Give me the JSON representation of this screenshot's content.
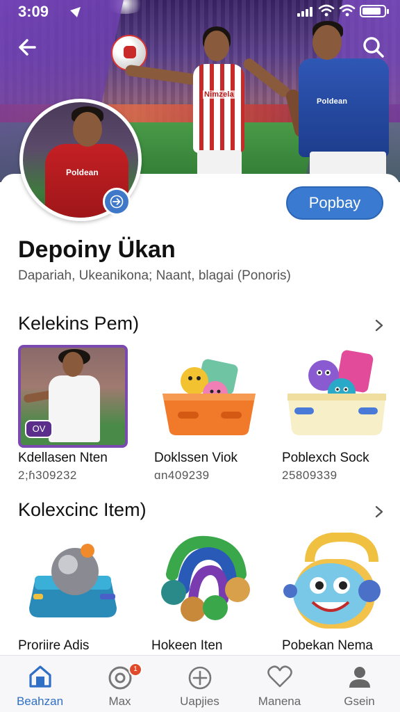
{
  "status_bar": {
    "time": "3:09"
  },
  "header": {
    "back_icon": "arrow-left-icon",
    "search_icon": "search-icon",
    "primary_button_label": "Popbay"
  },
  "profile": {
    "name": "Depoiny Ükan",
    "description": "Dapariah, Ukeanikona; Naant, blagai (Ponoris)",
    "avatar_jersey_text": "Poldean"
  },
  "hero": {
    "player1_jersey_text": "Nimzela",
    "player2_jersey_text": "Poldean"
  },
  "section1": {
    "title": "Kelekins Pem)",
    "items": [
      {
        "label": "Kdellasen Nten",
        "sub": "2;ɦ309232",
        "badge": "OV"
      },
      {
        "label": "Doklssen Viok",
        "sub": "ɑn409239"
      },
      {
        "label": "Poblexch Sock",
        "sub": "25809339"
      }
    ]
  },
  "section2": {
    "title": "Kolexcinc Item)",
    "items": [
      {
        "label": "Proriire Adis"
      },
      {
        "label": "Hokeen Iten"
      },
      {
        "label": "Pobekan Nema"
      }
    ]
  },
  "bottom_nav": {
    "items": [
      {
        "label": "Beahzan",
        "icon": "home-icon",
        "active": true
      },
      {
        "label": "Max",
        "icon": "camera-icon",
        "badge": "1"
      },
      {
        "label": "Uapjies",
        "icon": "plus-circle-icon"
      },
      {
        "label": "Manena",
        "icon": "heart-icon"
      },
      {
        "label": "Gsein",
        "icon": "person-icon"
      }
    ]
  },
  "colors": {
    "accent": "#3a7ad0",
    "brand_purple": "#6a3fa8",
    "badge": "#e04a2a"
  }
}
